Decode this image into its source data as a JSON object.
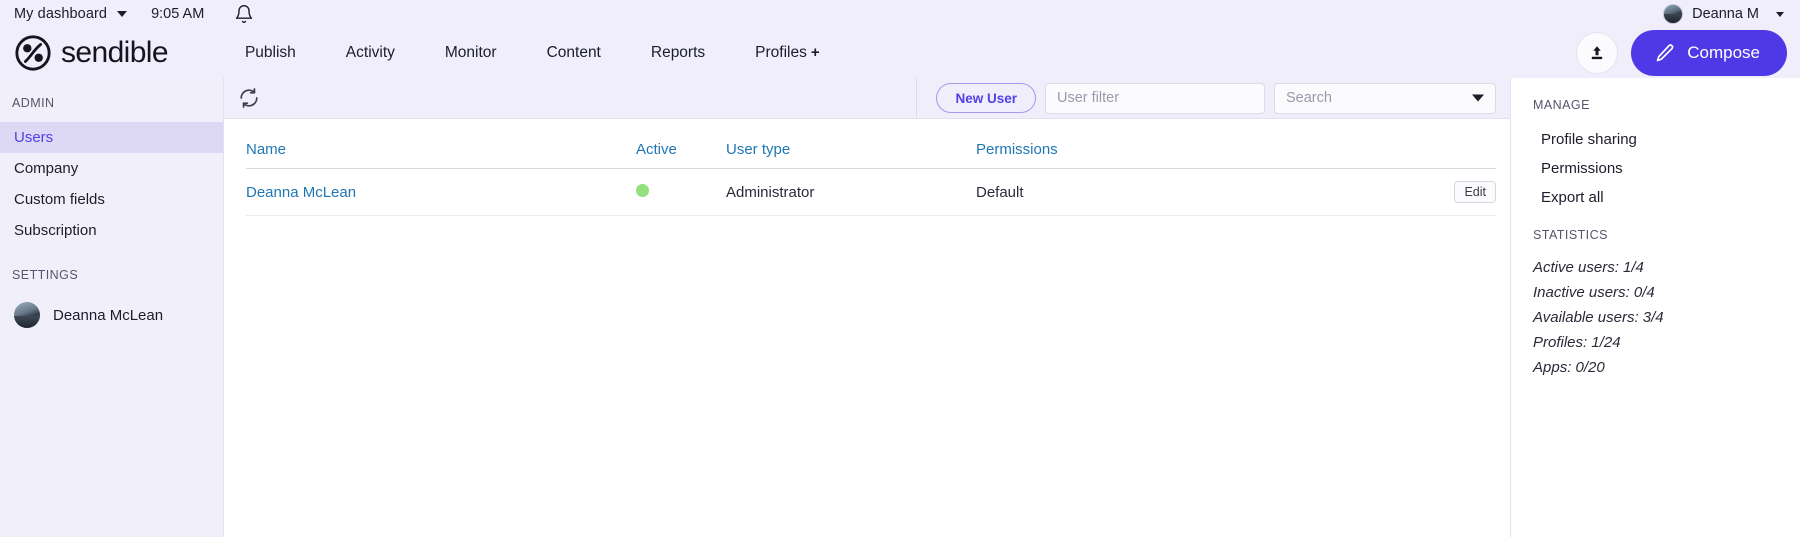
{
  "utility_bar": {
    "dashboard_label": "My dashboard",
    "time": "9:05 AM",
    "bell_icon": "bell-icon",
    "user_name": "Deanna M"
  },
  "navbar": {
    "brand": "sendible",
    "links": [
      {
        "label": "Publish",
        "suffix": ""
      },
      {
        "label": "Activity",
        "suffix": ""
      },
      {
        "label": "Monitor",
        "suffix": ""
      },
      {
        "label": "Content",
        "suffix": ""
      },
      {
        "label": "Reports",
        "suffix": ""
      },
      {
        "label": "Profiles",
        "suffix": "+"
      }
    ],
    "upload_icon": "upload-icon",
    "compose_label": "Compose",
    "compose_color": "#4f39e6"
  },
  "sidebar": {
    "admin_label": "ADMIN",
    "items": [
      {
        "label": "Users",
        "active": true
      },
      {
        "label": "Company",
        "active": false
      },
      {
        "label": "Custom fields",
        "active": false
      },
      {
        "label": "Subscription",
        "active": false
      }
    ],
    "settings_label": "SETTINGS",
    "user_name": "Deanna McLean",
    "active_bg": "#ddd9f5",
    "active_fg": "#5240e8"
  },
  "toolbar": {
    "refresh_icon": "refresh-icon",
    "new_user_label": "New User",
    "user_filter_placeholder": "User filter",
    "user_filter_value": "",
    "search_placeholder": "Search",
    "search_value": ""
  },
  "table": {
    "columns": [
      "Name",
      "Active",
      "User type",
      "Permissions",
      ""
    ],
    "rows": [
      {
        "name": "Deanna McLean",
        "active": true,
        "user_type": "Administrator",
        "permissions": "Default",
        "action": "Edit"
      }
    ],
    "header_color": "#1f78b4",
    "active_dot_color": "#92e07e"
  },
  "right_panel": {
    "manage_label": "MANAGE",
    "manage_items": [
      {
        "label": "Profile sharing"
      },
      {
        "label": "Permissions"
      },
      {
        "label": "Export all"
      }
    ],
    "statistics_label": "STATISTICS",
    "statistics": [
      {
        "label": "Active users: 1/4"
      },
      {
        "label": "Inactive users: 0/4"
      },
      {
        "label": "Available users: 3/4"
      },
      {
        "label": "Profiles: 1/24"
      },
      {
        "label": "Apps: 0/20"
      }
    ]
  }
}
